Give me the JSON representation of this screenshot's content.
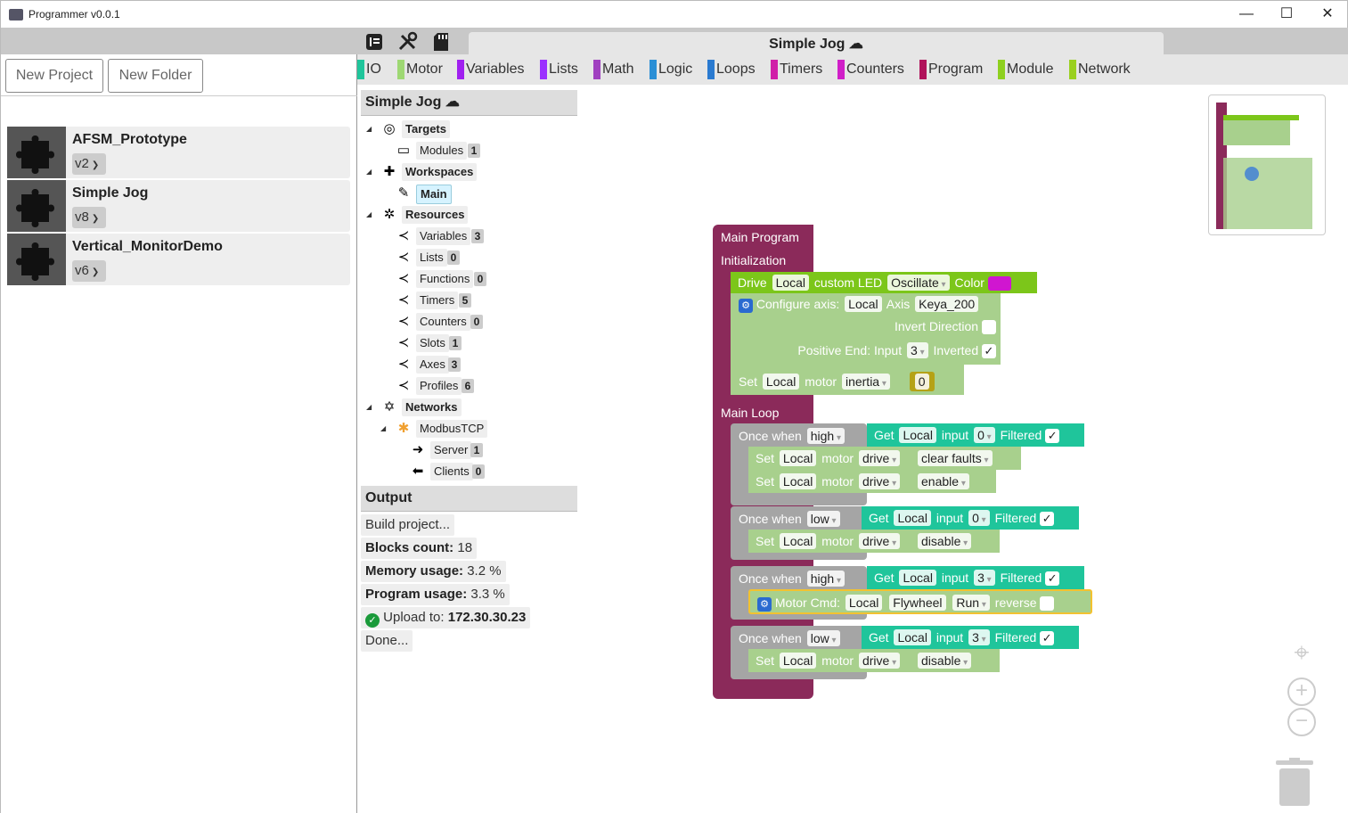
{
  "window": {
    "title": "Programmer v0.0.1",
    "minimize": "—",
    "maximize": "☐",
    "close": "✕"
  },
  "left": {
    "new_project": "New Project",
    "new_folder": "New Folder",
    "projects": [
      {
        "name": "AFSM_Prototype",
        "version": "v2"
      },
      {
        "name": "Simple Jog",
        "version": "v8"
      },
      {
        "name": "Vertical_MonitorDemo",
        "version": "v6"
      }
    ]
  },
  "editor": {
    "tab_title": "Simple Jog",
    "categories": [
      {
        "label": "IO",
        "color": "#1fc59b"
      },
      {
        "label": "Motor",
        "color": "#9ed873"
      },
      {
        "label": "Variables",
        "color": "#a020f0"
      },
      {
        "label": "Lists",
        "color": "#9b30ff"
      },
      {
        "label": "Math",
        "color": "#a040c0"
      },
      {
        "label": "Logic",
        "color": "#2a8fd6"
      },
      {
        "label": "Loops",
        "color": "#2a7ad0"
      },
      {
        "label": "Timers",
        "color": "#d01fa8"
      },
      {
        "label": "Counters",
        "color": "#d01fc8"
      },
      {
        "label": "Program",
        "color": "#b0125a"
      },
      {
        "label": "Module",
        "color": "#8ed01f"
      },
      {
        "label": "Network",
        "color": "#9ad01f"
      }
    ]
  },
  "tree": {
    "header": "Simple Jog",
    "targets": "Targets",
    "modules": {
      "label": "Modules",
      "count": "1"
    },
    "workspaces": "Workspaces",
    "main": "Main",
    "resources": "Resources",
    "items": [
      {
        "label": "Variables",
        "count": "3"
      },
      {
        "label": "Lists",
        "count": "0"
      },
      {
        "label": "Functions",
        "count": "0"
      },
      {
        "label": "Timers",
        "count": "5"
      },
      {
        "label": "Counters",
        "count": "0"
      },
      {
        "label": "Slots",
        "count": "1"
      },
      {
        "label": "Axes",
        "count": "3"
      },
      {
        "label": "Profiles",
        "count": "6"
      }
    ],
    "networks": "Networks",
    "modbus": "ModbusTCP",
    "server": {
      "label": "Server",
      "count": "1"
    },
    "clients": {
      "label": "Clients",
      "count": "0"
    }
  },
  "output": {
    "header": "Output",
    "build": "Build project...",
    "blocks_label": "Blocks count:",
    "blocks_value": "18",
    "memory_label": "Memory usage:",
    "memory_value": "3.2 %",
    "program_label": "Program usage:",
    "program_value": "3.3 %",
    "upload_label": "Upload to:",
    "upload_value": "172.30.30.23",
    "done": "Done..."
  },
  "blocks": {
    "main_program": "Main Program",
    "initialization": "Initialization",
    "drive": "Drive",
    "local": "Local",
    "custom_led": "custom LED",
    "oscillate": "Oscillate",
    "color": "Color",
    "configure_axis": "Configure axis:",
    "axis": "Axis",
    "keya": "Keya_200",
    "invert_direction": "Invert Direction",
    "positive_end": "Positive End: Input",
    "three": "3",
    "inverted": "Inverted",
    "set": "Set",
    "motor": "motor",
    "inertia": "inertia",
    "zero": "0",
    "main_loop": "Main Loop",
    "once_when": "Once when",
    "high": "high",
    "low": "low",
    "get": "Get",
    "input": "input",
    "filtered": "Filtered",
    "drive_word": "drive",
    "clear_faults": "clear faults",
    "enable": "enable",
    "disable": "disable",
    "motor_cmd": "Motor Cmd:",
    "flywheel": "Flywheel",
    "run": "Run",
    "reverse": "reverse",
    "check": "✓"
  }
}
